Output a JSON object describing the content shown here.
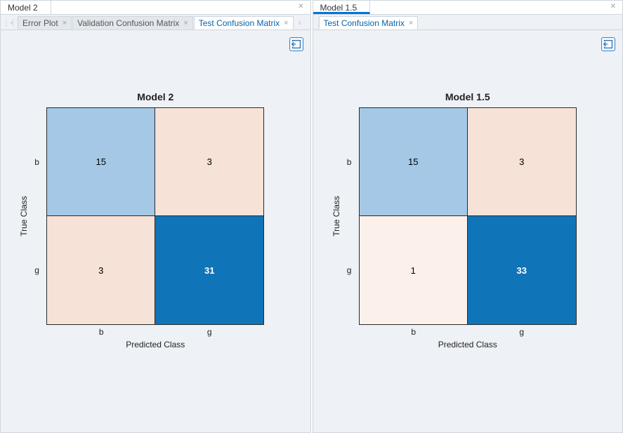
{
  "left": {
    "model_tab": "Model 2",
    "subtabs": {
      "error_plot": "Error Plot",
      "validation_cm": "Validation Confusion Matrix",
      "test_cm": "Test Confusion Matrix"
    },
    "title": "Model 2",
    "ylabel": "True Class",
    "xlabel": "Predicted Class",
    "tick_b": "b",
    "tick_g": "g",
    "cells": {
      "tl": "15",
      "tr": "3",
      "bl": "3",
      "br": "31"
    }
  },
  "right": {
    "model_tab": "Model 1.5",
    "subtabs": {
      "test_cm": "Test Confusion Matrix"
    },
    "title": "Model 1.5",
    "ylabel": "True Class",
    "xlabel": "Predicted Class",
    "tick_b": "b",
    "tick_g": "g",
    "cells": {
      "tl": "15",
      "tr": "3",
      "bl": "1",
      "br": "33"
    }
  },
  "chart_data": [
    {
      "type": "heatmap",
      "title": "Model 2",
      "xlabel": "Predicted Class",
      "ylabel": "True Class",
      "x_categories": [
        "b",
        "g"
      ],
      "y_categories": [
        "b",
        "g"
      ],
      "values": [
        [
          15,
          3
        ],
        [
          3,
          31
        ]
      ]
    },
    {
      "type": "heatmap",
      "title": "Model 1.5",
      "xlabel": "Predicted Class",
      "ylabel": "True Class",
      "x_categories": [
        "b",
        "g"
      ],
      "y_categories": [
        "b",
        "g"
      ],
      "values": [
        [
          15,
          3
        ],
        [
          1,
          33
        ]
      ]
    }
  ],
  "colors": {
    "correct_high": "#1074b8",
    "correct_low": "#a4c8e5",
    "wrong_med": "#f6e2d7",
    "wrong_low": "#fbf1ea"
  }
}
